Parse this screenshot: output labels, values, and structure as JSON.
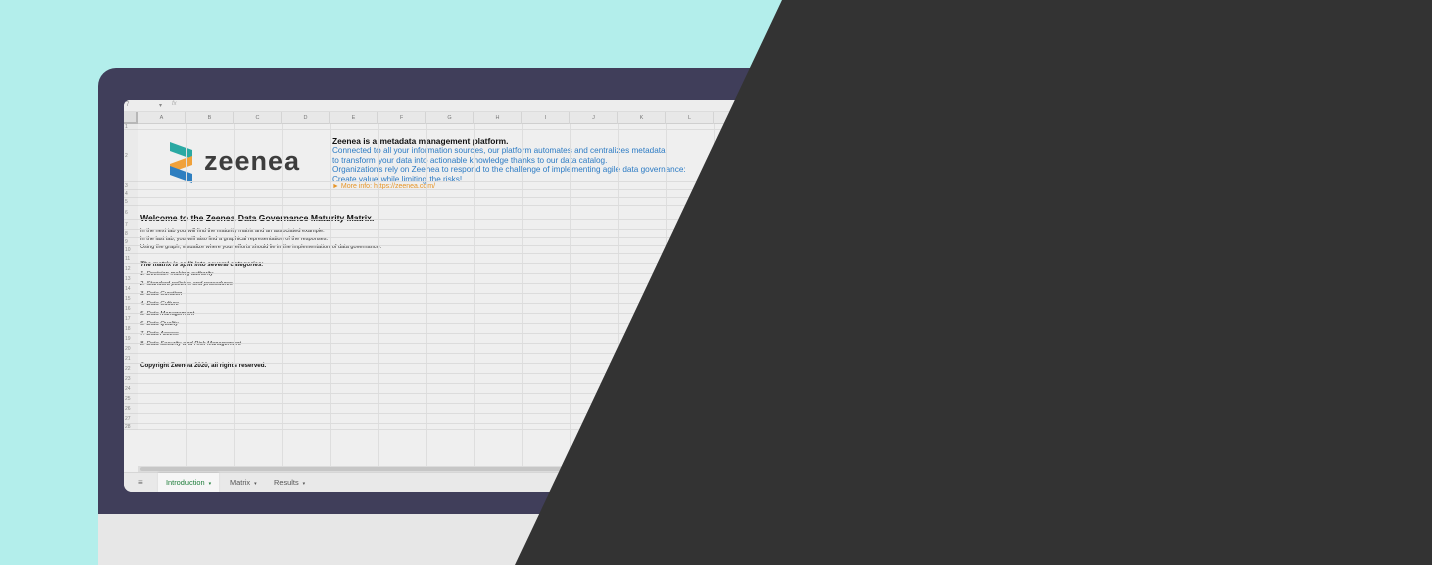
{
  "formula_bar": {
    "cell_ref": "7",
    "caret": "▾",
    "fx": "fx"
  },
  "columns": [
    "A",
    "B",
    "C",
    "D",
    "E",
    "F",
    "G",
    "H",
    "I",
    "J",
    "K",
    "L"
  ],
  "rows": [
    "1",
    "2",
    "3",
    "4",
    "5",
    "6",
    "7",
    "8",
    "9",
    "10",
    "11",
    "12",
    "13",
    "14",
    "15",
    "16",
    "17",
    "18",
    "19",
    "20",
    "21",
    "22",
    "23",
    "24",
    "25",
    "26",
    "27",
    "28"
  ],
  "logo": {
    "wordmark": "zeenea",
    "colors": [
      "#2aa9a3",
      "#f0a13a",
      "#2f7fc0"
    ]
  },
  "intro": {
    "title": "Zeenea is a metadata management platform.",
    "lines": [
      "Connected to all your information sources, our platform automates and centralizes metadata",
      "to transform your data into actionable knowledge thanks to our data catalog.",
      "Organizations rely on Zeenea to respond to the challenge of implementing agile data governance:",
      "Create value while limiting the risks!"
    ],
    "more_info_arrow": "►",
    "more_info_label": "More info: https://zeenea.com/"
  },
  "welcome": "Welcome to the Zeenea Data Governance Maturity Matrix.",
  "description": [
    "In the next tab you will find the maturity matrix and an associated example.",
    "In the last tab, you will also find a graphical representation of the responses.",
    "Using the graph, visualize where your efforts should lie in the implementation of data governance."
  ],
  "categories_title": "The matrix is split into several categories:",
  "categories": [
    "1. Decision-making authority",
    "2. Standard policies and procedures",
    "3. Data Curation",
    "4. Data Culture",
    "5. Data Management",
    "6. Data Quality",
    "7. Data Access",
    "8. Data Security and Risk Management"
  ],
  "copyright": "Copyright Zeenea 2020, all rights reserved.",
  "sheet_tabs": {
    "menu_icon": "≡",
    "tab_caret": "▾",
    "items": [
      {
        "label": "Introduction",
        "active": true
      },
      {
        "label": "Matrix",
        "active": false
      },
      {
        "label": "Results",
        "active": false
      }
    ]
  },
  "colors": {
    "background": "#b3eeeb",
    "frame": "#403e5a",
    "overlay": "#333333",
    "link": "#2c7bc4",
    "more_info": "#e69528",
    "active_tab": "#1e7d3a"
  }
}
